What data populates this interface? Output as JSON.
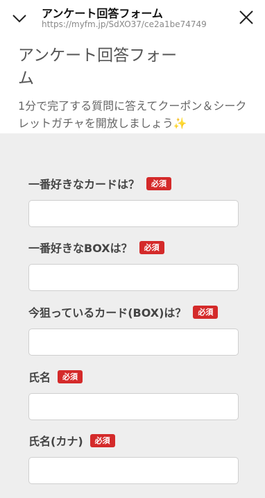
{
  "header": {
    "title": "アンケート回答フォーム",
    "url": "https://myfm.jp/SdXO37/ce2a1be74749",
    "collapse_icon": "chevron-down-icon",
    "close_icon": "close-icon"
  },
  "hero": {
    "heading": "アンケート回答フォーム",
    "description": "1分で完了する質問に答えてクーポン＆シークレットガチャを開放しましょう✨"
  },
  "form": {
    "required_badge": "必須",
    "fields": [
      {
        "label": "一番好きなカードは？",
        "required": true,
        "value": ""
      },
      {
        "label": "一番好きなBOXは？",
        "required": true,
        "value": ""
      },
      {
        "label": "今狙っているカード(BOX)は？",
        "required": true,
        "value": ""
      },
      {
        "label": "氏名",
        "required": true,
        "value": ""
      },
      {
        "label": "氏名(カナ)",
        "required": true,
        "value": ""
      }
    ]
  },
  "colors": {
    "required_badge_bg": "#d42a2a",
    "form_background": "#eeeeee"
  }
}
